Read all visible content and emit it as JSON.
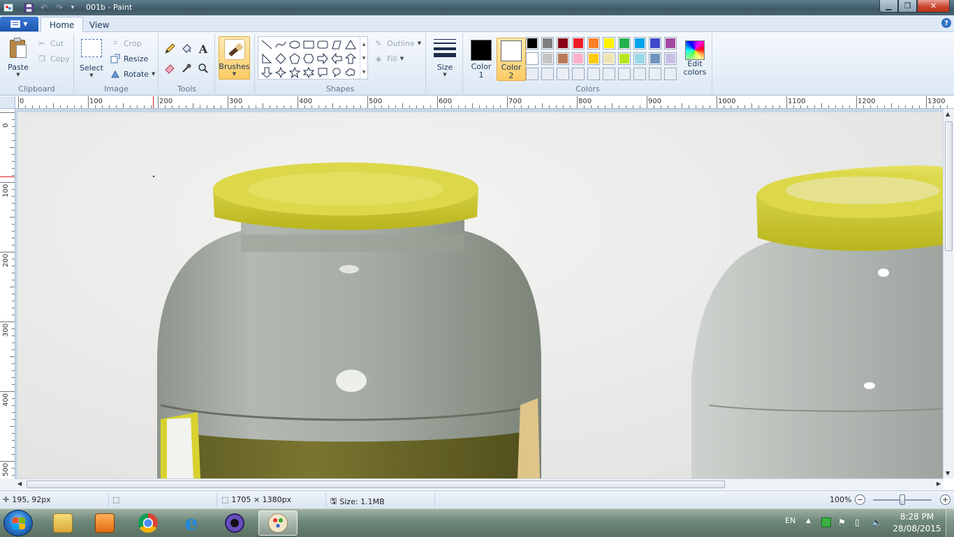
{
  "window": {
    "title": "001b - Paint",
    "controls": {
      "minimize": "▁",
      "maximize": "❐",
      "close": "✕"
    }
  },
  "tabs": [
    {
      "label": "Home",
      "active": true
    },
    {
      "label": "View",
      "active": false
    }
  ],
  "ribbon": {
    "clipboard": {
      "group_label": "Clipboard",
      "paste": "Paste",
      "cut": "Cut",
      "copy": "Copy"
    },
    "image": {
      "group_label": "Image",
      "select": "Select",
      "crop": "Crop",
      "resize": "Resize",
      "rotate": "Rotate"
    },
    "tools": {
      "group_label": "Tools"
    },
    "brushes": {
      "label": "Brushes"
    },
    "shapes": {
      "group_label": "Shapes",
      "outline": "Outline",
      "fill": "Fill"
    },
    "size": {
      "label": "Size"
    },
    "colors": {
      "group_label": "Colors",
      "color1_label": "Color 1",
      "color1_value": "#000000",
      "color2_label": "Color 2",
      "color2_value": "#ffffff",
      "edit_label": "Edit colors",
      "palette_row1": [
        "#000000",
        "#7f7f7f",
        "#880015",
        "#ed1c24",
        "#ff7f27",
        "#fff200",
        "#22b14c",
        "#00a2e8",
        "#3f48cc",
        "#a349a4"
      ],
      "palette_row2": [
        "#ffffff",
        "#c3c3c3",
        "#b97a57",
        "#ffaec9",
        "#ffc90e",
        "#efe4b0",
        "#b5e61d",
        "#99d9ea",
        "#7092be",
        "#c8bfe7"
      ]
    }
  },
  "rulers": {
    "top": [
      "0",
      "100",
      "200",
      "300",
      "400",
      "500",
      "600",
      "700",
      "800",
      "900",
      "1000",
      "1100",
      "1200",
      "1300"
    ],
    "left": [
      "0",
      "100",
      "200",
      "300",
      "400",
      "500"
    ]
  },
  "status": {
    "cursor_pos": "195, 92px",
    "image_size": "1705 × 1380px",
    "file_size": "Size: 1.1MB",
    "zoom": "100%",
    "zoom_out": "−",
    "zoom_in": "+"
  },
  "taskbar": {
    "language": "EN",
    "time": "8:28 PM",
    "date": "28/08/2015"
  }
}
